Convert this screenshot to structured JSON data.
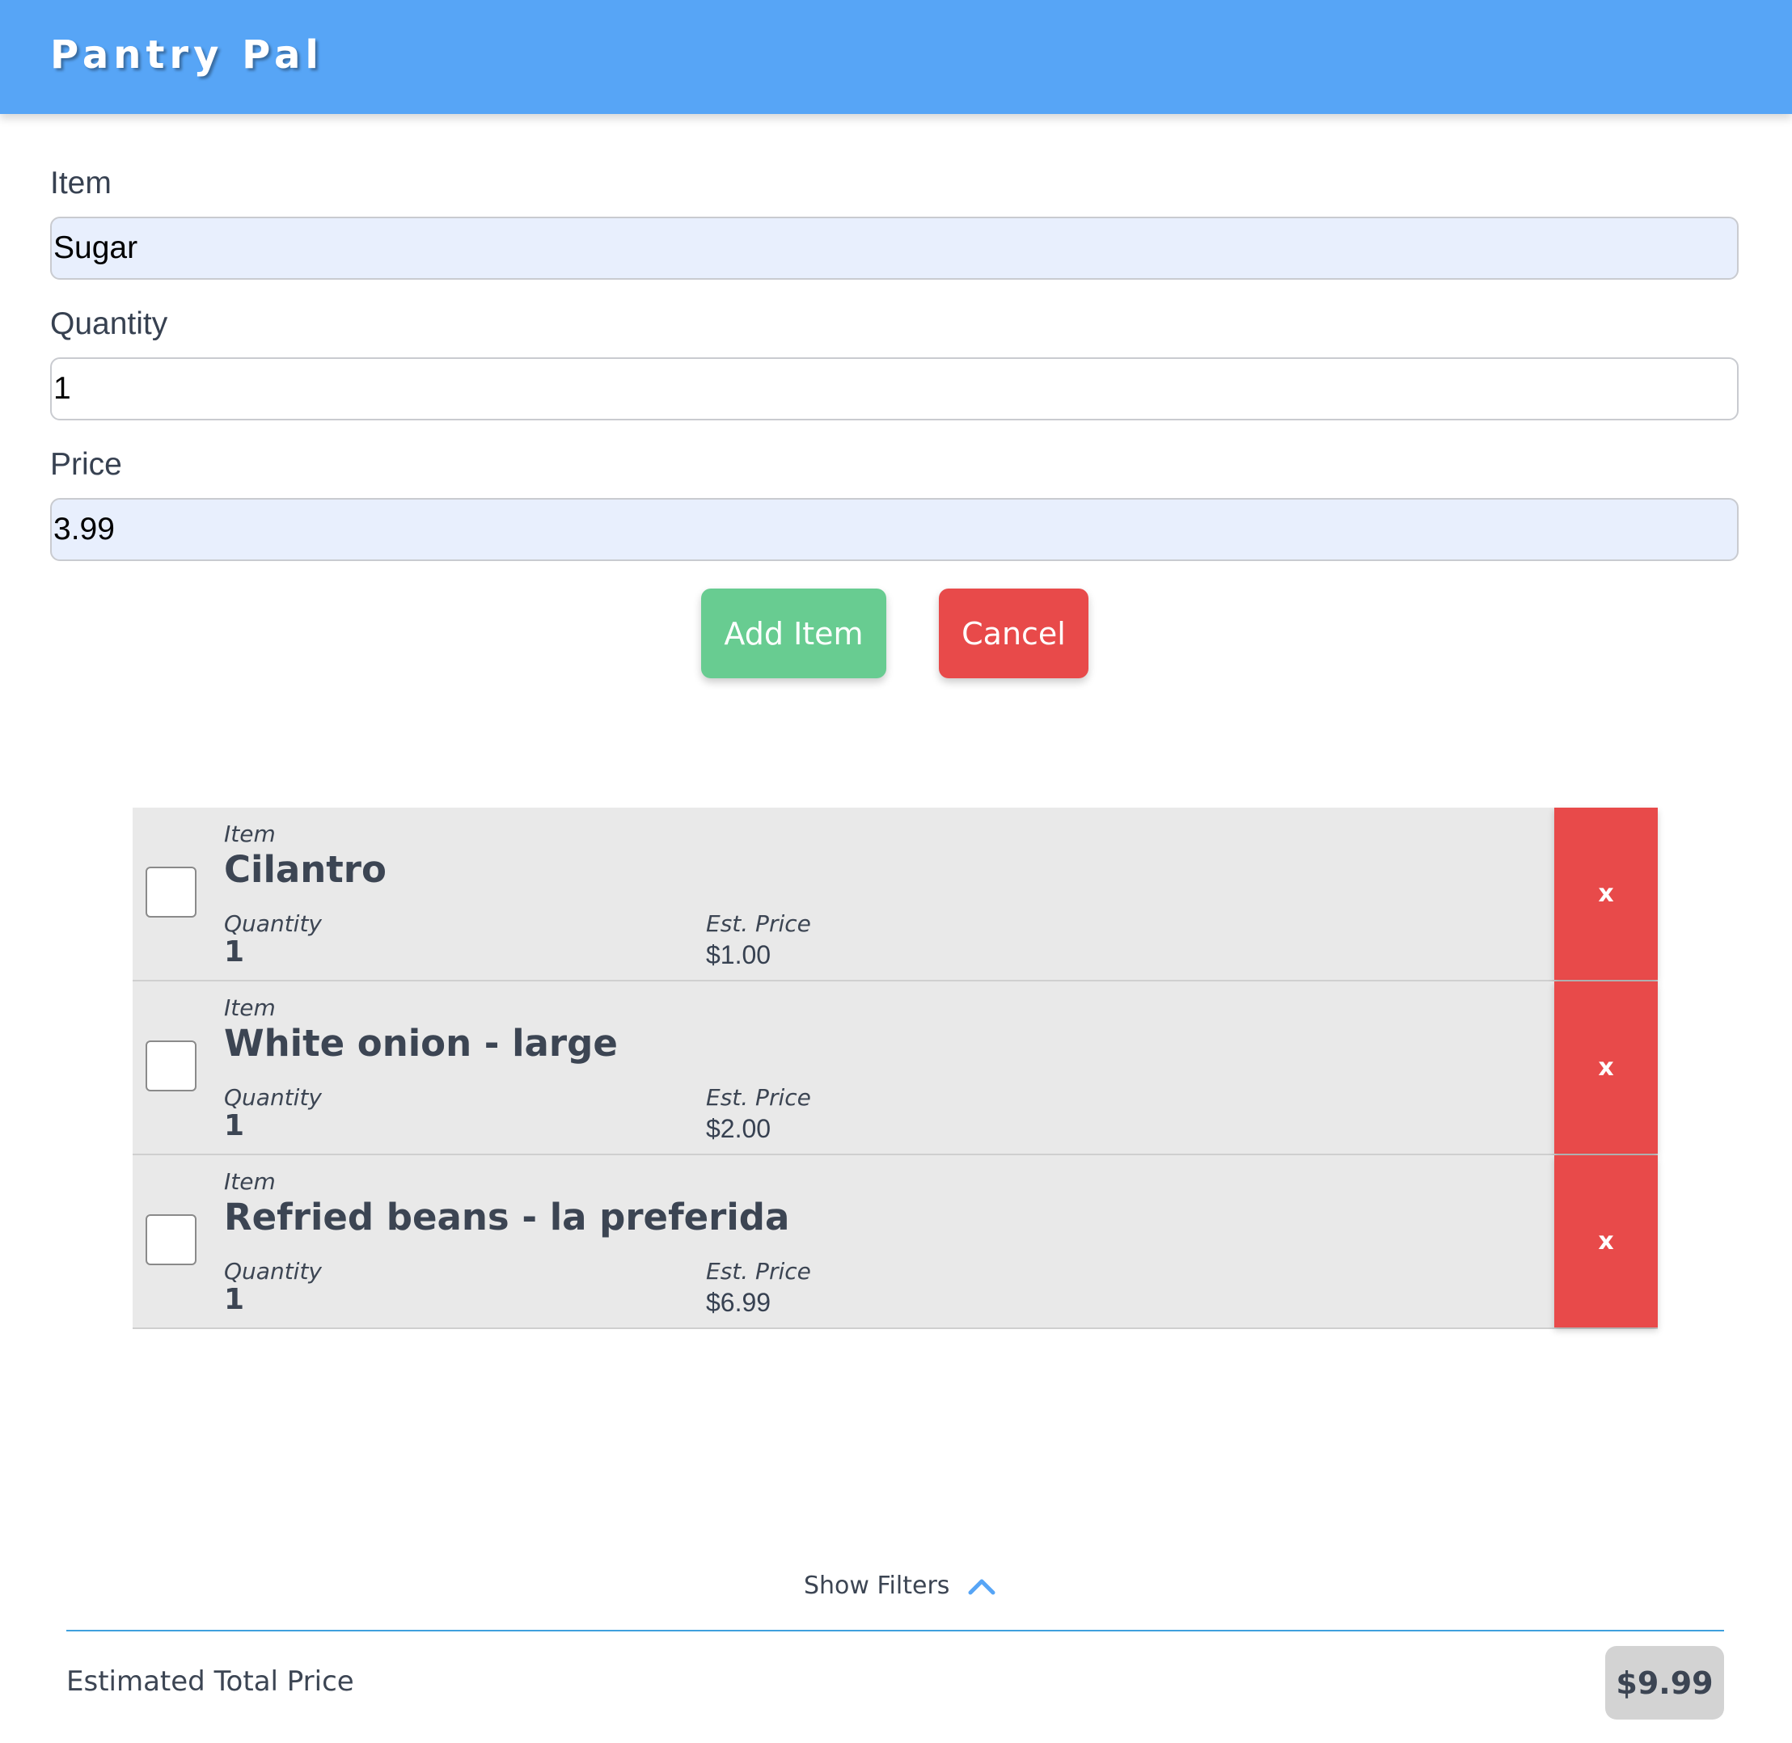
{
  "header": {
    "title": "Pantry Pal"
  },
  "form": {
    "item_label": "Item",
    "item_value": "Sugar",
    "quantity_label": "Quantity",
    "quantity_value": "1",
    "price_label": "Price",
    "price_value": "3.99",
    "add_label": "Add Item",
    "cancel_label": "Cancel"
  },
  "list": {
    "item_label": "Item",
    "quantity_label": "Quantity",
    "price_label": "Est. Price",
    "delete_label": "x",
    "items": [
      {
        "name": "Cilantro",
        "quantity": "1",
        "price": "$1.00",
        "checked": false
      },
      {
        "name": "White onion - large",
        "quantity": "1",
        "price": "$2.00",
        "checked": false
      },
      {
        "name": "Refried beans - la preferida",
        "quantity": "1",
        "price": "$6.99",
        "checked": false
      }
    ]
  },
  "filters": {
    "label": "Show Filters",
    "icon": "chevron-up-icon"
  },
  "footer": {
    "total_label": "Estimated Total Price",
    "total_value": "$9.99"
  },
  "colors": {
    "header": "#57a5f6",
    "add_button": "#68cc91",
    "cancel_button": "#e84a4a",
    "delete_button": "#e84a4a",
    "row_background": "#e9e9e9",
    "divider": "#3fa0dd",
    "total_badge": "#d3d3d3",
    "input_autofill": "#e8effd"
  }
}
